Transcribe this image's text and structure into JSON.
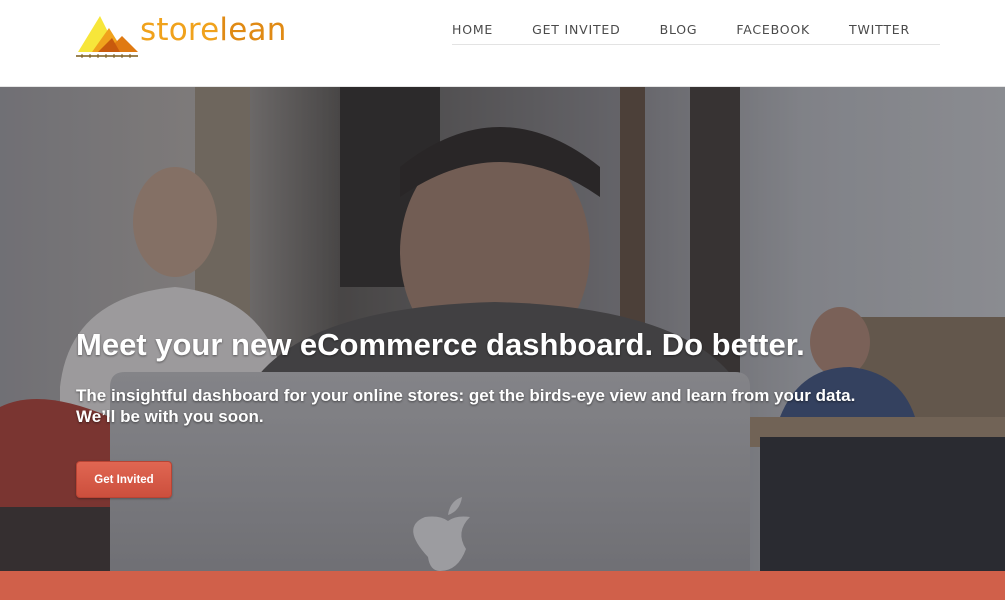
{
  "brand": {
    "name_part1": "store",
    "name_part2": "lean",
    "logo_icon": "mountains-logo-icon"
  },
  "nav": {
    "items": [
      {
        "label": "HOME"
      },
      {
        "label": "GET INVITED"
      },
      {
        "label": "BLOG"
      },
      {
        "label": "FACEBOOK"
      },
      {
        "label": "TWITTER"
      }
    ]
  },
  "hero": {
    "title": "Meet your new eCommerce dashboard. Do better.",
    "subtitle_line1": "The insightful dashboard for your online stores: get the birds-eye view and learn from your data.",
    "subtitle_line2": "We’ll be with you soon.",
    "cta_label": "Get Invited"
  },
  "colors": {
    "accent": "#d0604a",
    "brand_orange": "#f0a21c",
    "logo_yellow": "#f6df2a"
  }
}
